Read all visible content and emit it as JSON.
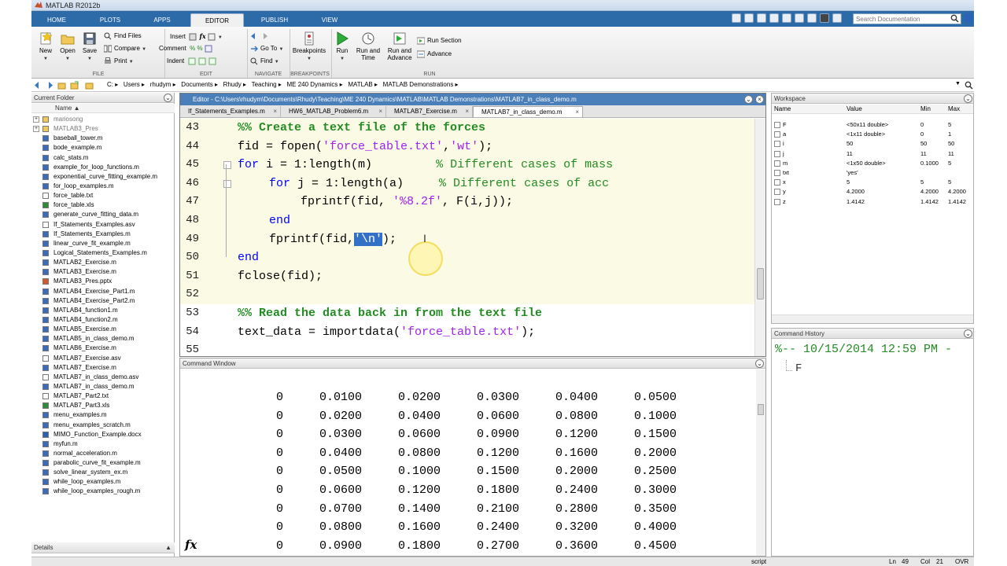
{
  "window": {
    "title": "MATLAB R2012b"
  },
  "ribbon_tabs": [
    "HOME",
    "PLOTS",
    "APPS",
    "EDITOR",
    "PUBLISH",
    "VIEW"
  ],
  "active_tab": "EDITOR",
  "search": {
    "placeholder": "Search Documentation"
  },
  "ribbon": {
    "file": {
      "new": "New",
      "open": "Open",
      "save": "Save",
      "find_files": "Find Files",
      "compare": "Compare",
      "print": "Print",
      "group": "FILE"
    },
    "edit": {
      "insert": "Insert",
      "comment": "Comment",
      "indent": "Indent",
      "group": "EDIT"
    },
    "navigate": {
      "go_to": "Go To",
      "find": "Find",
      "group": "NAVIGATE"
    },
    "breakpoints": {
      "label": "Breakpoints",
      "group": "BREAKPOINTS"
    },
    "run": {
      "run": "Run",
      "run_and_time": "Run and Time",
      "run_and_advance": "Run and Advance",
      "run_section": "Run Section",
      "advance": "Advance",
      "group": "RUN"
    }
  },
  "address_bar": {
    "crumbs": [
      "C:",
      "Users",
      "rhudym",
      "Documents",
      "Rhudy",
      "Teaching",
      "ME 240 Dynamics",
      "MATLAB",
      "MATLAB Demonstrations"
    ]
  },
  "current_folder": {
    "title": "Current Folder",
    "column": "Name",
    "files": [
      {
        "name": "mariosong",
        "type": "folder",
        "grey": true
      },
      {
        "name": "MATLAB3_Pres",
        "type": "folder",
        "grey": true
      },
      {
        "name": "baseball_tower.m",
        "type": "m"
      },
      {
        "name": "bode_example.m",
        "type": "m"
      },
      {
        "name": "calc_stats.m",
        "type": "m"
      },
      {
        "name": "example_for_loop_functions.m",
        "type": "m"
      },
      {
        "name": "exponential_curve_fitting_example.m",
        "type": "m"
      },
      {
        "name": "for_loop_examples.m",
        "type": "m"
      },
      {
        "name": "force_table.txt",
        "type": "txt"
      },
      {
        "name": "force_table.xls",
        "type": "xls"
      },
      {
        "name": "generate_curve_fitting_data.m",
        "type": "m"
      },
      {
        "name": "If_Statements_Examples.asv",
        "type": "asv"
      },
      {
        "name": "If_Statements_Examples.m",
        "type": "m"
      },
      {
        "name": "linear_curve_fit_example.m",
        "type": "m"
      },
      {
        "name": "Logical_Statements_Examples.m",
        "type": "m"
      },
      {
        "name": "MATLAB2_Exercise.m",
        "type": "m"
      },
      {
        "name": "MATLAB3_Exercise.m",
        "type": "m"
      },
      {
        "name": "MATLAB3_Pres.pptx",
        "type": "pptx"
      },
      {
        "name": "MATLAB4_Exercise_Part1.m",
        "type": "m"
      },
      {
        "name": "MATLAB4_Exercise_Part2.m",
        "type": "m"
      },
      {
        "name": "MATLAB4_function1.m",
        "type": "m"
      },
      {
        "name": "MATLAB4_function2.m",
        "type": "m"
      },
      {
        "name": "MATLAB5_Exercise.m",
        "type": "m"
      },
      {
        "name": "MATLAB5_in_class_demo.m",
        "type": "m"
      },
      {
        "name": "MATLAB6_Exercise.m",
        "type": "m"
      },
      {
        "name": "MATLAB7_Exercise.asv",
        "type": "asv"
      },
      {
        "name": "MATLAB7_Exercise.m",
        "type": "m"
      },
      {
        "name": "MATLAB7_in_class_demo.asv",
        "type": "asv"
      },
      {
        "name": "MATLAB7_in_class_demo.m",
        "type": "m"
      },
      {
        "name": "MATLAB7_Part2.txt",
        "type": "txt"
      },
      {
        "name": "MATLAB7_Part3.xls",
        "type": "xls"
      },
      {
        "name": "menu_examples.m",
        "type": "m"
      },
      {
        "name": "menu_examples_scratch.m",
        "type": "m"
      },
      {
        "name": "MIMO_Function_Example.docx",
        "type": "docx"
      },
      {
        "name": "myfun.m",
        "type": "m"
      },
      {
        "name": "normal_acceleration.m",
        "type": "m"
      },
      {
        "name": "parabolic_curve_fit_example.m",
        "type": "m"
      },
      {
        "name": "solve_linear_system_ex.m",
        "type": "m"
      },
      {
        "name": "while_loop_examples.m",
        "type": "m"
      },
      {
        "name": "while_loop_examples_rough.m",
        "type": "m"
      }
    ],
    "details": "Details"
  },
  "editor": {
    "title": "Editor - C:\\Users\\rhudym\\Documents\\Rhudy\\Teaching\\ME 240 Dynamics\\MATLAB\\MATLAB Demonstrations\\MATLAB7_in_class_demo.m",
    "tabs": [
      "If_Statements_Examples.m",
      "HW6_MATLAB_Problem6.m",
      "MATLAB7_Exercise.m",
      "MATLAB7_in_class_demo.m"
    ],
    "line_numbers": [
      "43",
      "44",
      "45",
      "46",
      "47",
      "48",
      "49",
      "50",
      "51",
      "52",
      "53",
      "54",
      "55"
    ],
    "code": {
      "l43": "%% Create a text file of the forces",
      "l44a": "fid = fopen(",
      "l44b": "'force_table.txt'",
      "l44c": ",",
      "l44d": "'wt'",
      "l44e": ");",
      "l45a": "for",
      "l45b": " i = 1:length(m)         ",
      "l45c": "% Different cases of mass",
      "l46a": "for",
      "l46b": " j = 1:length(a)     ",
      "l46c": "% Different cases of acc",
      "l47a": "fprintf(fid, ",
      "l47b": "'%8.2f'",
      "l47c": ", F(i,j));",
      "l48": "end",
      "l49a": "fprintf(fid,",
      "l49b": "'\\n'",
      "l49c": ");",
      "l50": "end",
      "l51": "fclose(fid);",
      "l53": "%% Read the data back in from the text file",
      "l54a": "text_data = importdata(",
      "l54b": "'force_table.txt'",
      "l54c": ");"
    }
  },
  "command_window": {
    "title": "Command Window",
    "rows": [
      [
        "0",
        "0.0100",
        "0.0200",
        "0.0300",
        "0.0400",
        "0.0500"
      ],
      [
        "0",
        "0.0200",
        "0.0400",
        "0.0600",
        "0.0800",
        "0.1000"
      ],
      [
        "0",
        "0.0300",
        "0.0600",
        "0.0900",
        "0.1200",
        "0.1500"
      ],
      [
        "0",
        "0.0400",
        "0.0800",
        "0.1200",
        "0.1600",
        "0.2000"
      ],
      [
        "0",
        "0.0500",
        "0.1000",
        "0.1500",
        "0.2000",
        "0.2500"
      ],
      [
        "0",
        "0.0600",
        "0.1200",
        "0.1800",
        "0.2400",
        "0.3000"
      ],
      [
        "0",
        "0.0700",
        "0.1400",
        "0.2100",
        "0.2800",
        "0.3500"
      ],
      [
        "0",
        "0.0800",
        "0.1600",
        "0.2400",
        "0.3200",
        "0.4000"
      ],
      [
        "0",
        "0.0900",
        "0.1800",
        "0.2700",
        "0.3600",
        "0.4500"
      ]
    ],
    "prompt": "fx"
  },
  "workspace": {
    "title": "Workspace",
    "columns": [
      "Name",
      "Value",
      "Min",
      "Max"
    ],
    "vars": [
      {
        "name": "F",
        "value": "<50x11 double>",
        "min": "0",
        "max": "5"
      },
      {
        "name": "a",
        "value": "<1x11 double>",
        "min": "0",
        "max": "1"
      },
      {
        "name": "i",
        "value": "50",
        "min": "50",
        "max": "50"
      },
      {
        "name": "j",
        "value": "11",
        "min": "11",
        "max": "11"
      },
      {
        "name": "m",
        "value": "<1x50 double>",
        "min": "0.1000",
        "max": "5"
      },
      {
        "name": "txt",
        "value": "'yes'",
        "min": "",
        "max": ""
      },
      {
        "name": "x",
        "value": "5",
        "min": "5",
        "max": "5"
      },
      {
        "name": "y",
        "value": "4.2000",
        "min": "4.2000",
        "max": "4.2000"
      },
      {
        "name": "z",
        "value": "1.4142",
        "min": "1.4142",
        "max": "1.4142"
      }
    ]
  },
  "command_history": {
    "title": "Command History",
    "date": "%-- 10/15/2014 12:59 PM -",
    "entry": "F"
  },
  "status": {
    "mode": "script",
    "ln_label": "Ln",
    "ln": "49",
    "col_label": "Col",
    "col": "21",
    "ovr": "OVR"
  },
  "colors": {
    "tab_bar": "#2d6aa8",
    "keyword": "#0000ff",
    "string": "#a020f0",
    "comment": "#228b22",
    "cell_bg": "#fbfbe5",
    "selection": "#3370c8"
  }
}
